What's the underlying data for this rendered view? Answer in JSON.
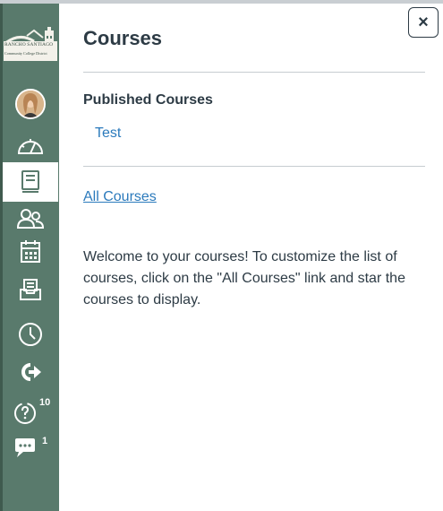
{
  "logo": {
    "line1": "RANCHO SANTIAGO",
    "line2": "Community College District"
  },
  "nav": {
    "items": [
      {
        "id": "account",
        "icon": "avatar-icon"
      },
      {
        "id": "dashboard",
        "icon": "dashboard-icon"
      },
      {
        "id": "courses",
        "icon": "courses-icon",
        "active": true
      },
      {
        "id": "groups",
        "icon": "groups-icon"
      },
      {
        "id": "calendar",
        "icon": "calendar-icon"
      },
      {
        "id": "inbox",
        "icon": "inbox-icon"
      },
      {
        "id": "history",
        "icon": "history-icon"
      },
      {
        "id": "external",
        "icon": "external-arrow-icon"
      },
      {
        "id": "help",
        "icon": "help-icon",
        "badge": "10"
      },
      {
        "id": "chat",
        "icon": "chat-icon",
        "badge": "1"
      }
    ]
  },
  "tray": {
    "title": "Courses",
    "close_label": "×",
    "published_heading": "Published Courses",
    "courses": [
      "Test"
    ],
    "all_courses_label": "All Courses",
    "welcome_text": "Welcome to your courses! To customize the list of courses, click on the \"All Courses\" link and star the courses to display."
  },
  "colors": {
    "sidebar": "#597a6c",
    "link": "#2b7abc",
    "text": "#2d3b45"
  }
}
